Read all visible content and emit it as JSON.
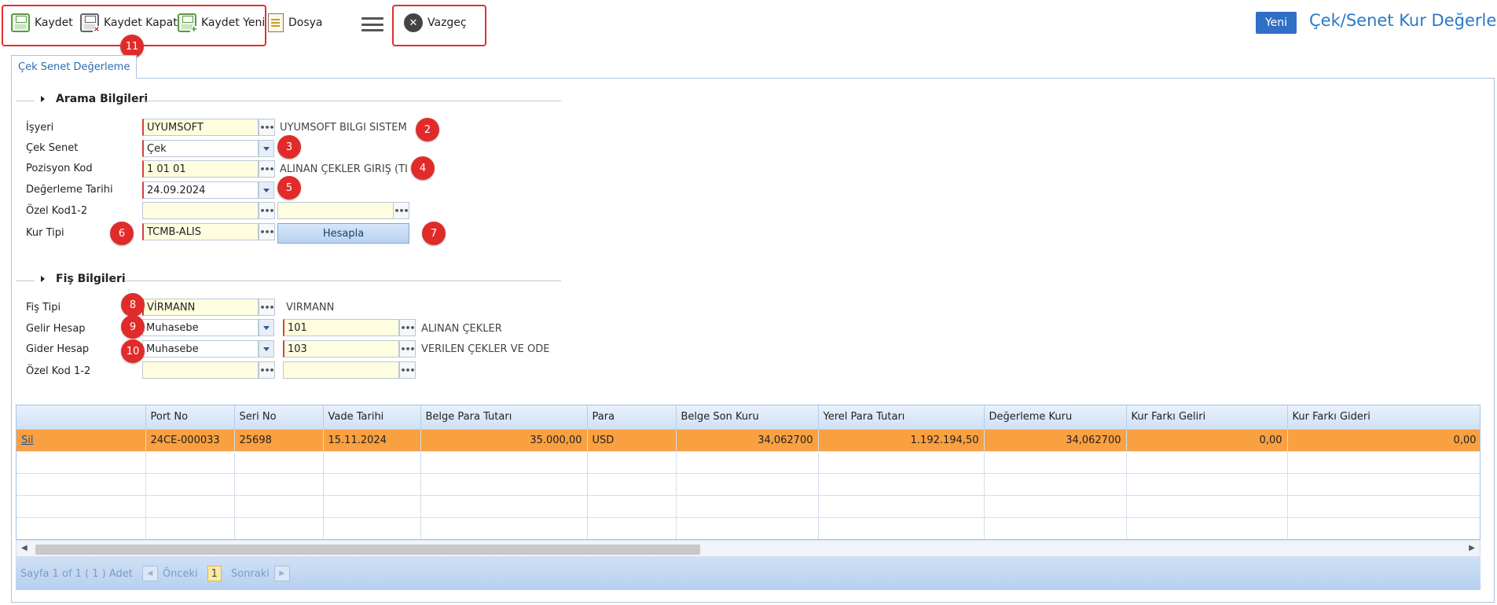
{
  "toolbar": {
    "save_label": "Kaydet",
    "save_close_label": "Kaydet Kapat",
    "save_new_label": "Kaydet Yeni",
    "file_label": "Dosya",
    "cancel_label": "Vazgeç",
    "new_label": "Yeni",
    "page_title": "Çek/Senet Kur Değerleme",
    "marker": "11"
  },
  "tab": {
    "label": "Çek Senet Değerleme"
  },
  "search_section": {
    "title": "Arama Bilgileri",
    "fields": {
      "isyeri": {
        "label": "İşyeri",
        "value": "UYUMSOFT",
        "description": "UYUMSOFT BİLGİ SİSTEML"
      },
      "cek_senet": {
        "label": "Çek Senet",
        "value": "Çek"
      },
      "pozisyon_kod": {
        "label": "Pozisyon Kod",
        "value": "1 01 01",
        "description": "ALINAN ÇEKLER GİRİŞ (TL)"
      },
      "degerleme_tarihi": {
        "label": "Değerleme Tarihi",
        "value": "24.09.2024"
      },
      "ozel_kod": {
        "label": "Özel Kod1-2",
        "value1": "",
        "value2": ""
      },
      "kur_tipi": {
        "label": "Kur Tipi",
        "value": "TCMB-ALIS"
      }
    },
    "calculate_label": "Hesapla"
  },
  "voucher_section": {
    "title": "Fiş Bilgileri",
    "fields": {
      "fis_tipi": {
        "label": "Fiş Tipi",
        "value": "VİRMANN",
        "description": "VİRMANN"
      },
      "gelir_hesap": {
        "label": "Gelir Hesap",
        "type": "Muhasebe",
        "code": "101",
        "description": "ALINAN ÇEKLER"
      },
      "gider_hesap": {
        "label": "Gider Hesap",
        "type": "Muhasebe",
        "code": "103",
        "description": "VERİLEN ÇEKLER VE ÖDEM"
      },
      "ozel_kod": {
        "label": "Özel Kod 1-2",
        "value1": "",
        "value2": ""
      }
    }
  },
  "markers": [
    "2",
    "3",
    "4",
    "5",
    "6",
    "7",
    "8",
    "9",
    "10"
  ],
  "grid": {
    "headers": [
      "",
      "Port No",
      "Seri No",
      "Vade Tarihi",
      "Belge Para Tutarı",
      "Para",
      "Belge Son Kuru",
      "Yerel Para Tutarı",
      "Değerleme Kuru",
      "Kur Farkı Geliri",
      "Kur Farkı Gideri"
    ],
    "row": {
      "delete_label": "Sil",
      "port_no": "24CE-000033",
      "seri_no": "25698",
      "vade_tarihi": "15.11.2024",
      "belge_para_tutari": "35.000,00",
      "para": "USD",
      "belge_son_kuru": "34,062700",
      "yerel_para_tutari": "1.192.194,50",
      "degerleme_kuru": "34,062700",
      "kur_farki_geliri": "0,00",
      "kur_farki_gideri": "0,00"
    },
    "scroll_left": "◀",
    "scroll_right": "▶"
  },
  "pager": {
    "summary": "Sayfa 1 of 1 ( 1 ) Adet",
    "prev_label": "Önceki",
    "current_page": "1",
    "next_label": "Sonraki",
    "prev_arrow": "◀",
    "next_arrow": "▶"
  },
  "icons": [
    "save-icon",
    "save-close-icon",
    "save-new-icon",
    "document-icon",
    "hamburger-menu-icon",
    "close-circle-icon",
    "triangle-right-icon",
    "ellipsis-icon",
    "dropdown-arrow-icon"
  ],
  "colors": {
    "accent": "#2b78c7",
    "new_button": "#2f6fc6",
    "highlight_row": "#f9a040",
    "marker": "#e12b2b",
    "required_field": "#fffde0"
  }
}
